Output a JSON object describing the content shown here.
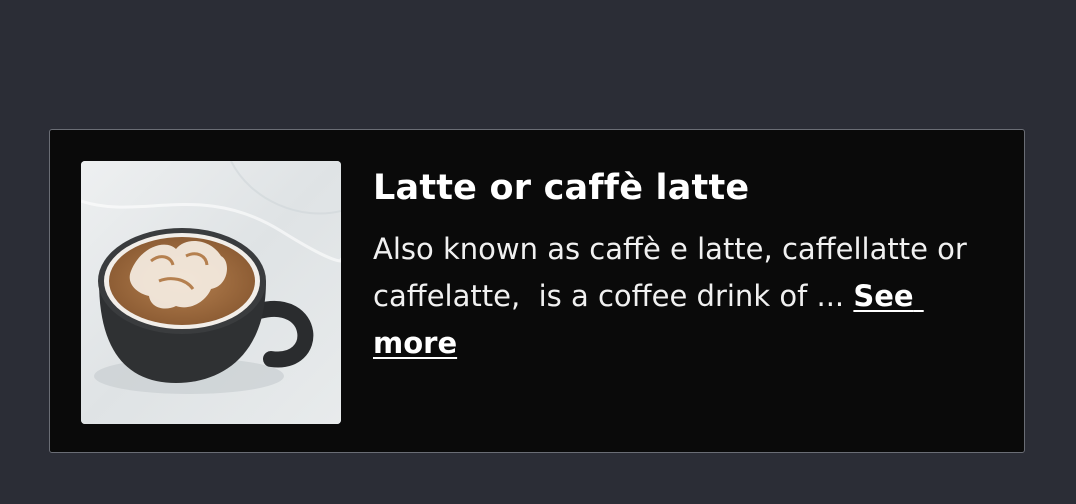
{
  "card": {
    "image": {
      "icon": "latte-cup-image",
      "alt": "Cup of latte with latte art"
    },
    "title": "Latte or caffè latte",
    "description": "Also known as caffè e latte, caffellatte or caffelatte,  is a coffee drink of ... ",
    "see_more_label": "See more"
  },
  "colors": {
    "page_background": "#2b2d36",
    "card_background": "#0a0a0a",
    "card_border": "#6a6d75",
    "text": "#ffffff"
  }
}
